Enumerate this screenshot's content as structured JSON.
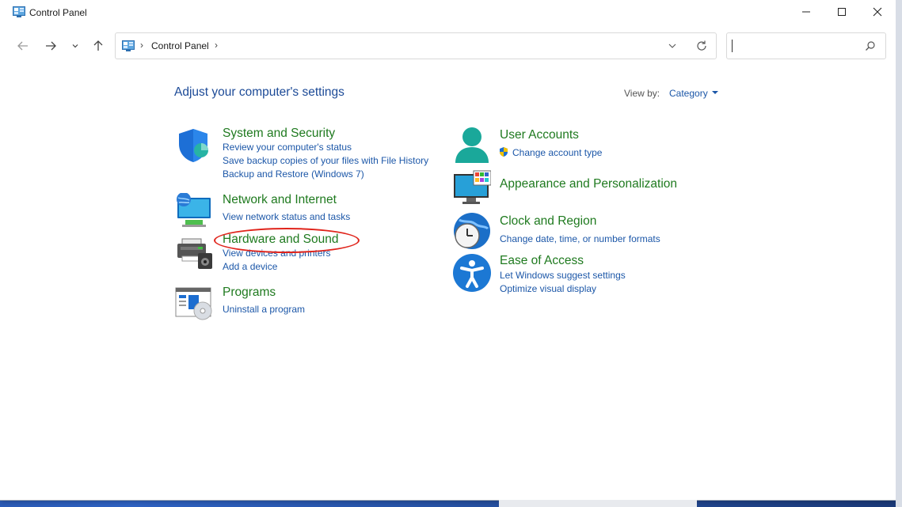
{
  "window": {
    "title": "Control Panel"
  },
  "address": {
    "location": "Control Panel",
    "separator": "›"
  },
  "search": {
    "placeholder": ""
  },
  "main": {
    "heading": "Adjust your computer's settings",
    "view_by_label": "View by:",
    "view_by_value": "Category"
  },
  "categories": {
    "system": {
      "title": "System and Security",
      "links": [
        "Review your computer's status",
        "Save backup copies of your files with File History",
        "Backup and Restore (Windows 7)"
      ]
    },
    "network": {
      "title": "Network and Internet",
      "links": [
        "View network status and tasks"
      ]
    },
    "hardware": {
      "title": "Hardware and Sound",
      "links": [
        "View devices and printers",
        "Add a device"
      ]
    },
    "programs": {
      "title": "Programs",
      "links": [
        "Uninstall a program"
      ]
    },
    "user": {
      "title": "User Accounts",
      "links": [
        "Change account type"
      ]
    },
    "appearance": {
      "title": "Appearance and Personalization",
      "links": []
    },
    "clock": {
      "title": "Clock and Region",
      "links": [
        "Change date, time, or number formats"
      ]
    },
    "ease": {
      "title": "Ease of Access",
      "links": [
        "Let Windows suggest settings",
        "Optimize visual display"
      ]
    }
  },
  "icons": {
    "app": "control-panel-icon",
    "back": "back-arrow-icon",
    "forward": "forward-arrow-icon",
    "recent": "chevron-down-icon",
    "up": "up-arrow-icon",
    "refresh": "refresh-icon",
    "search": "search-icon",
    "shield": "uac-shield-icon"
  },
  "colors": {
    "heading": "#1c4a97",
    "category_title": "#1f7a1f",
    "link": "#1c57a8",
    "annotation": "#e0241b"
  }
}
